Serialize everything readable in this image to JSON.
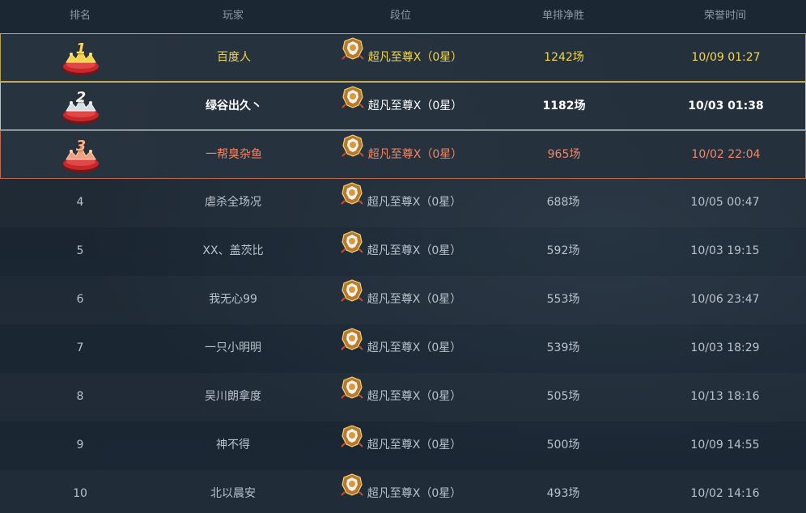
{
  "header": {
    "rank": "排名",
    "player": "玩家",
    "tier": "段位",
    "wins": "单排净胜",
    "time": "荣誉时间"
  },
  "rows": [
    {
      "rank": "1",
      "player": "百度人",
      "tier": "超凡至尊Ⅹ（0星）",
      "wins": "1242场",
      "time": "10/09 01:27"
    },
    {
      "rank": "2",
      "player": "绿谷出久丶",
      "tier": "超凡至尊Ⅹ（0星）",
      "wins": "1182场",
      "time": "10/03 01:38"
    },
    {
      "rank": "3",
      "player": "一帮臭杂鱼",
      "tier": "超凡至尊Ⅹ（0星）",
      "wins": "965场",
      "time": "10/02 22:04"
    },
    {
      "rank": "4",
      "player": "虐杀全场况",
      "tier": "超凡至尊Ⅹ（0星）",
      "wins": "688场",
      "time": "10/05 00:47"
    },
    {
      "rank": "5",
      "player": "XX、盖茨比",
      "tier": "超凡至尊Ⅹ（0星）",
      "wins": "592场",
      "time": "10/03 19:15"
    },
    {
      "rank": "6",
      "player": "我无心99",
      "tier": "超凡至尊Ⅹ（0星）",
      "wins": "553场",
      "time": "10/06 23:47"
    },
    {
      "rank": "7",
      "player": "一只小明明",
      "tier": "超凡至尊Ⅹ（0星）",
      "wins": "539场",
      "time": "10/03 18:29"
    },
    {
      "rank": "8",
      "player": "吴川朗拿度",
      "tier": "超凡至尊Ⅹ（0星）",
      "wins": "505场",
      "time": "10/13 18:16"
    },
    {
      "rank": "9",
      "player": "神不得",
      "tier": "超凡至尊Ⅹ（0星）",
      "wins": "500场",
      "time": "10/09 14:55"
    },
    {
      "rank": "10",
      "player": "北以晨安",
      "tier": "超凡至尊Ⅹ（0星）",
      "wins": "493场",
      "time": "10/02 14:16"
    }
  ],
  "icons": {
    "rank_medal": "rank-medal-icon",
    "tier": "tier-badge-icon"
  },
  "colors": {
    "gold": "#f2d84a",
    "silver": "#ffffff",
    "bronze": "#f08868",
    "normal": "#b9c2ca",
    "header": "#8d98a3"
  }
}
